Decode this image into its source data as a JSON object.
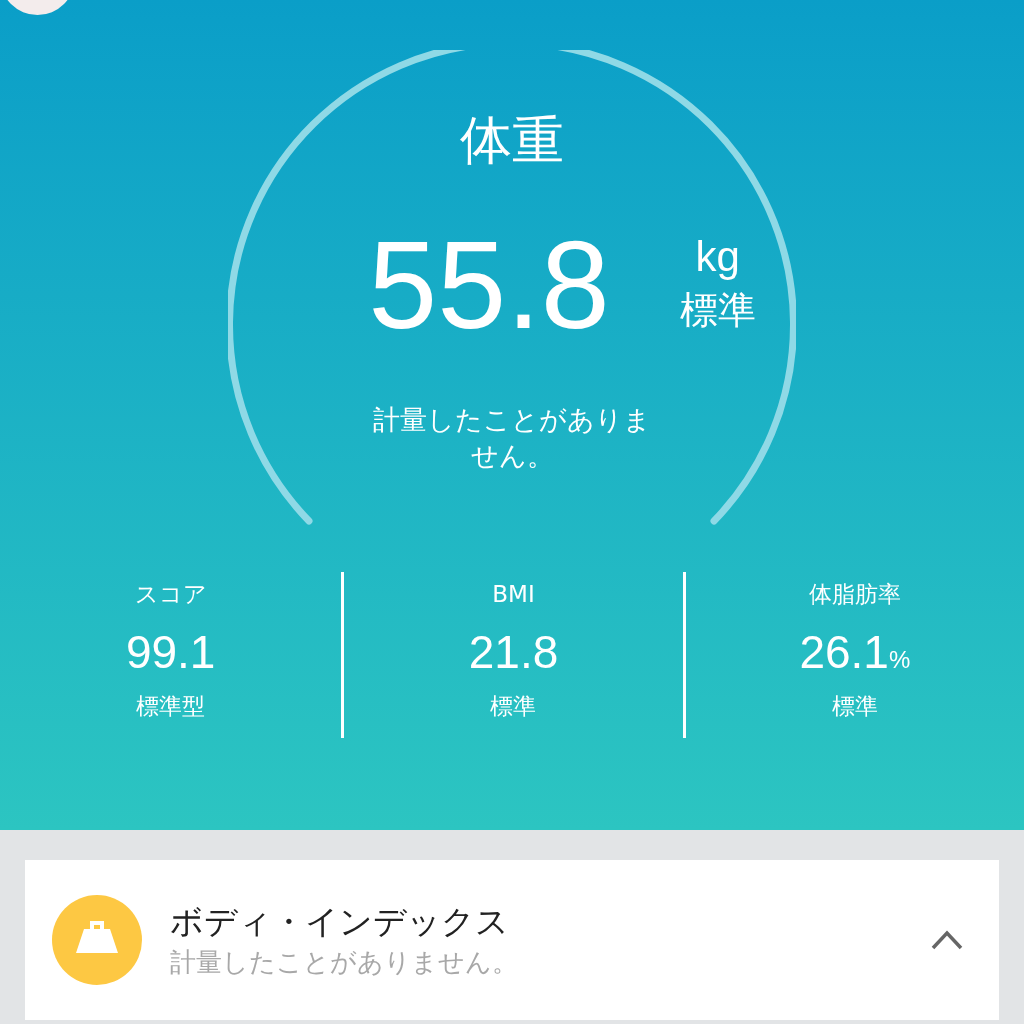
{
  "weight": {
    "title": "体重",
    "value": "55.8",
    "unit": "kg",
    "status": "標準",
    "message": "計量したことがありません。"
  },
  "stats": [
    {
      "label": "スコア",
      "value": "99.1",
      "status": "標準型"
    },
    {
      "label": "BMI",
      "value": "21.8",
      "status": "標準"
    },
    {
      "label": "体脂肪率",
      "value": "26.1",
      "unit": "%",
      "status": "標準"
    }
  ],
  "card": {
    "title": "ボディ・インデックス",
    "subtitle": "計量したことがありません。",
    "expanded": true
  }
}
